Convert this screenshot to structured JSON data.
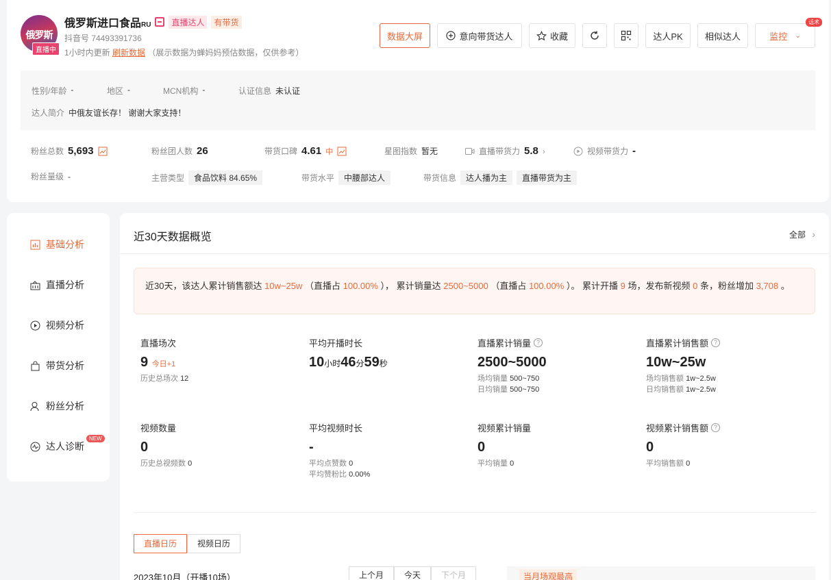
{
  "header": {
    "avatar_text": "俄罗斯",
    "live_tag": "直播中",
    "name": "俄罗斯进口食品",
    "name_suffix": "RU",
    "tag_live": "直播达人",
    "tag_goods": "有带货",
    "douyin_id": "抖音号 74493391736",
    "update_time": "1小时内更新",
    "refresh_link": "刷新数据",
    "update_note": "（展示数据为蝉妈妈预估数据，仅供参考）"
  },
  "actions": {
    "big_screen": "数据大屏",
    "intent": "意向带货达人",
    "favorite": "收藏",
    "pk": "达人PK",
    "similar": "相似达人",
    "monitor": "监控",
    "monitor_badge": "话术"
  },
  "profile": {
    "gender_label": "性别/年龄",
    "gender_value": "-",
    "region_label": "地区",
    "region_value": "-",
    "mcn_label": "MCN机构",
    "mcn_value": "-",
    "cert_label": "认证信息",
    "cert_value": "未认证",
    "intro_label": "达人简介",
    "intro_value": "中俄友谊长存！ 谢谢大家支持！"
  },
  "stats": {
    "fans_label": "粉丝总数",
    "fans_value": "5,693",
    "fans_group_label": "粉丝团人数",
    "fans_group_value": "26",
    "reputation_label": "带货口碑",
    "reputation_value": "4.61",
    "reputation_level": "中",
    "star_label": "星图指数",
    "star_value": "暂无",
    "live_power_label": "直播带货力",
    "live_power_value": "5.8",
    "video_power_label": "视频带货力",
    "video_power_value": "-",
    "fans_level_label": "粉丝量级",
    "fans_level_value": "-",
    "category_label": "主营类型",
    "category_value": "食品饮料  84.65%",
    "level_label": "带货水平",
    "level_value": "中腰部达人",
    "info_label": "带货信息",
    "info_value1": "达人播为主",
    "info_value2": "直播带货为主"
  },
  "sidebar": {
    "items": [
      {
        "label": "基础分析"
      },
      {
        "label": "直播分析"
      },
      {
        "label": "视频分析"
      },
      {
        "label": "带货分析"
      },
      {
        "label": "粉丝分析"
      },
      {
        "label": "达人诊断"
      }
    ],
    "new_badge": "NEW"
  },
  "overview": {
    "title": "近30天数据概览",
    "all_link": "全部",
    "summary": {
      "p1": "近30天，该达人累计销售额达 ",
      "sales": "10w~25w",
      "p2": " （直播占 ",
      "sales_live": "100.00%",
      "p3": " ）， 累计销量达 ",
      "volume": "2500~5000",
      "p4": " （直播占 ",
      "volume_live": "100.00%",
      "p5": " ）。 累计开播 ",
      "lives": "9",
      "p6": " 场，发布新视频 ",
      "videos": "0",
      "p7": " 条，粉丝增加 ",
      "fans_gain": "3,708",
      "p8": " 。"
    },
    "metrics": {
      "live_count": {
        "title": "直播场次",
        "value": "9",
        "today": "今日+1",
        "sub_label": "历史总场次",
        "sub_value": "12"
      },
      "avg_duration": {
        "title": "平均开播时长",
        "h": "10",
        "h_unit": "小时",
        "m": "46",
        "m_unit": "分",
        "s": "59",
        "s_unit": "秒"
      },
      "live_volume": {
        "title": "直播累计销量",
        "value": "2500~5000",
        "sub1_label": "场均销量",
        "sub1_value": "500~750",
        "sub2_label": "日均销量",
        "sub2_value": "500~750"
      },
      "live_sales": {
        "title": "直播累计销售额",
        "value": "10w~25w",
        "sub1_label": "场均销售额",
        "sub1_value": "1w~2.5w",
        "sub2_label": "日均销售额",
        "sub2_value": "1w~2.5w"
      },
      "video_count": {
        "title": "视频数量",
        "value": "0",
        "sub_label": "历史总视频数",
        "sub_value": "0"
      },
      "avg_video": {
        "title": "平均视频时长",
        "value": "-",
        "sub1_label": "平均点赞数",
        "sub1_value": "0",
        "sub2_label": "平均赞粉比",
        "sub2_value": "0.00%"
      },
      "video_volume": {
        "title": "视频累计销量",
        "value": "0",
        "sub_label": "平均销量",
        "sub_value": "0"
      },
      "video_sales": {
        "title": "视频累计销售额",
        "value": "0",
        "sub_label": "平均销售额",
        "sub_value": "0"
      }
    }
  },
  "calendar": {
    "tab_live": "直播日历",
    "tab_video": "视频日历",
    "month": "2023年10月（开播10场）",
    "prev": "上个月",
    "today": "今天",
    "next": "下个月",
    "best": "当月场观最高"
  },
  "colors": {
    "accent": "#e86a3a",
    "pink": "#e8436e"
  }
}
